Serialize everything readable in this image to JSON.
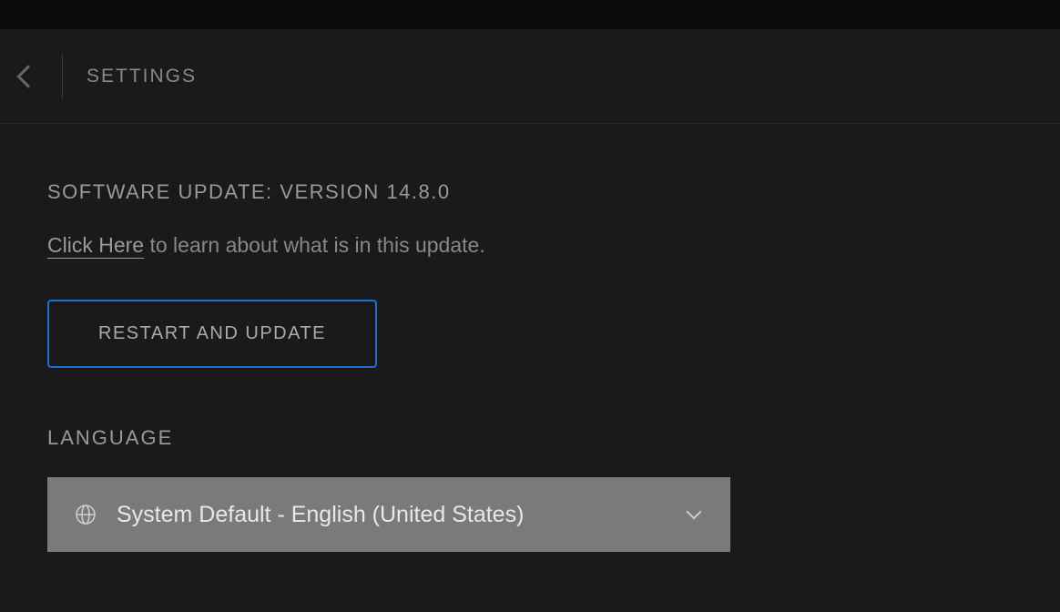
{
  "header": {
    "title": "SETTINGS"
  },
  "software_update": {
    "heading": "SOFTWARE UPDATE: VERSION 14.8.0",
    "link_text": "Click Here",
    "description_suffix": " to learn about what is in this update.",
    "button_label": "RESTART AND UPDATE"
  },
  "language": {
    "heading": "LANGUAGE",
    "selected": "System Default - English (United States)"
  }
}
